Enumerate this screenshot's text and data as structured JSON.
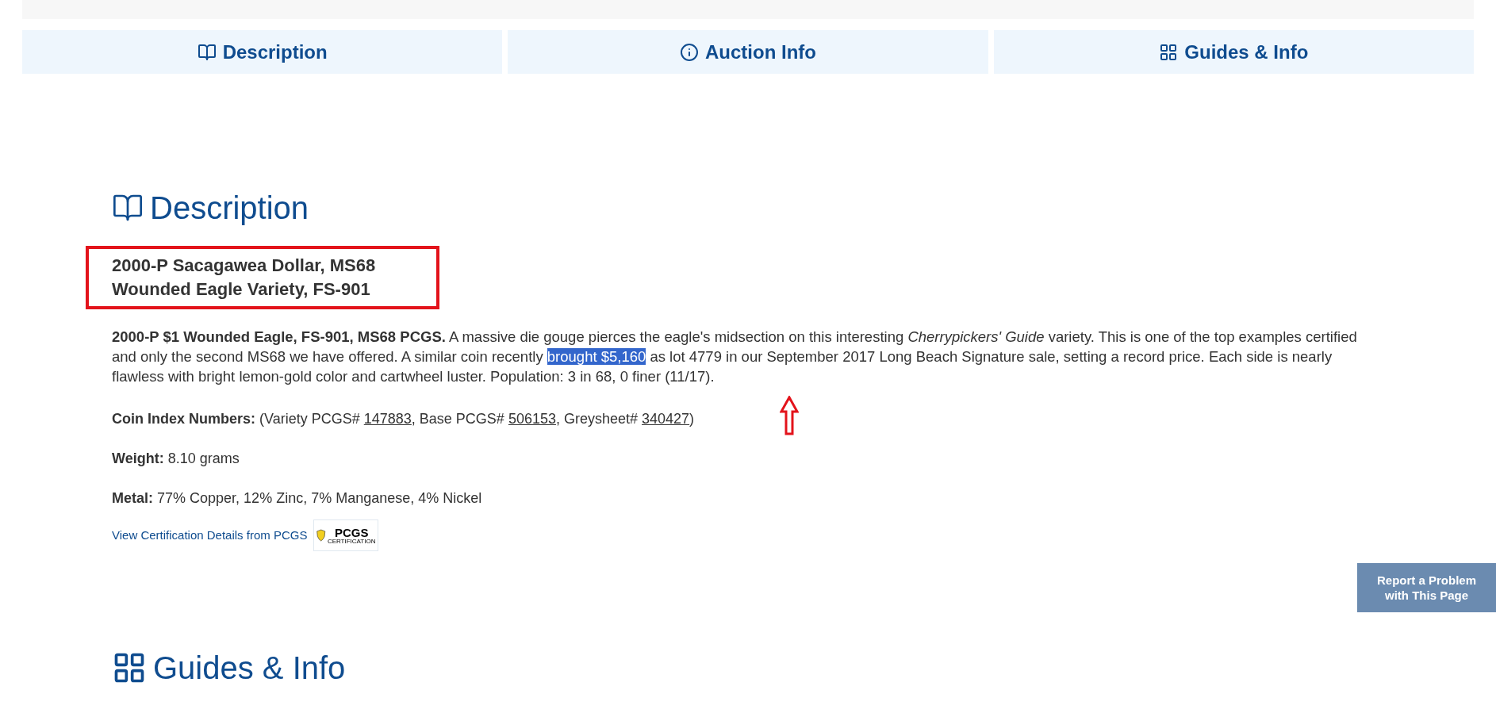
{
  "tabs": [
    {
      "label": "Description"
    },
    {
      "label": "Auction Info"
    },
    {
      "label": "Guides & Info"
    }
  ],
  "description": {
    "heading": "Description",
    "title_lines": [
      "2000-P Sacagawea Dollar, MS68",
      "Wounded Eagle Variety, FS-901"
    ],
    "paragraph": [
      {
        "text": "**2000-P $1 Wounded Eagle, FS-901, MS68 PCGS.** A massive die gouge pierces the eagle's midsection on this interesting *Cherrypickers' Guide* variety. This is one of the top examples certified and only the second MS68 we have offered. A similar coin recently ",
        "highlighted": false
      },
      {
        "text": "brought $5,160",
        "highlighted": true
      },
      {
        "text": " as lot 4779 in our September 2017 Long Beach Signature sale, setting a record price. Each side is nearly flawless with bright lemon-gold color and cartwheel luster. Population: 3 in 68, 0 finer (11/17).",
        "highlighted": false
      }
    ],
    "coin_index": {
      "label": "Coin Index Numbers:",
      "parts": [
        {
          "kind": "text",
          "text": " (Variety PCGS# "
        },
        {
          "kind": "link",
          "text": "147883"
        },
        {
          "kind": "text",
          "text": ", Base PCGS# "
        },
        {
          "kind": "link",
          "text": "506153"
        },
        {
          "kind": "text",
          "text": ", Greysheet# "
        },
        {
          "kind": "link",
          "text": "340427"
        },
        {
          "kind": "text",
          "text": ")"
        }
      ]
    },
    "weight": {
      "label": "Weight:",
      "value": "8.10 grams"
    },
    "metal": {
      "label": "Metal:",
      "value": "77% Copper, 12% Zinc, 7% Manganese, 4% Nickel"
    },
    "cert_link": "View Certification Details from PCGS",
    "cert_logo": {
      "brand": "PCGS",
      "caption": "CERTIFICATION"
    }
  },
  "guides_heading": "Guides & Info",
  "report_button": "Report a Problem with This Page"
}
